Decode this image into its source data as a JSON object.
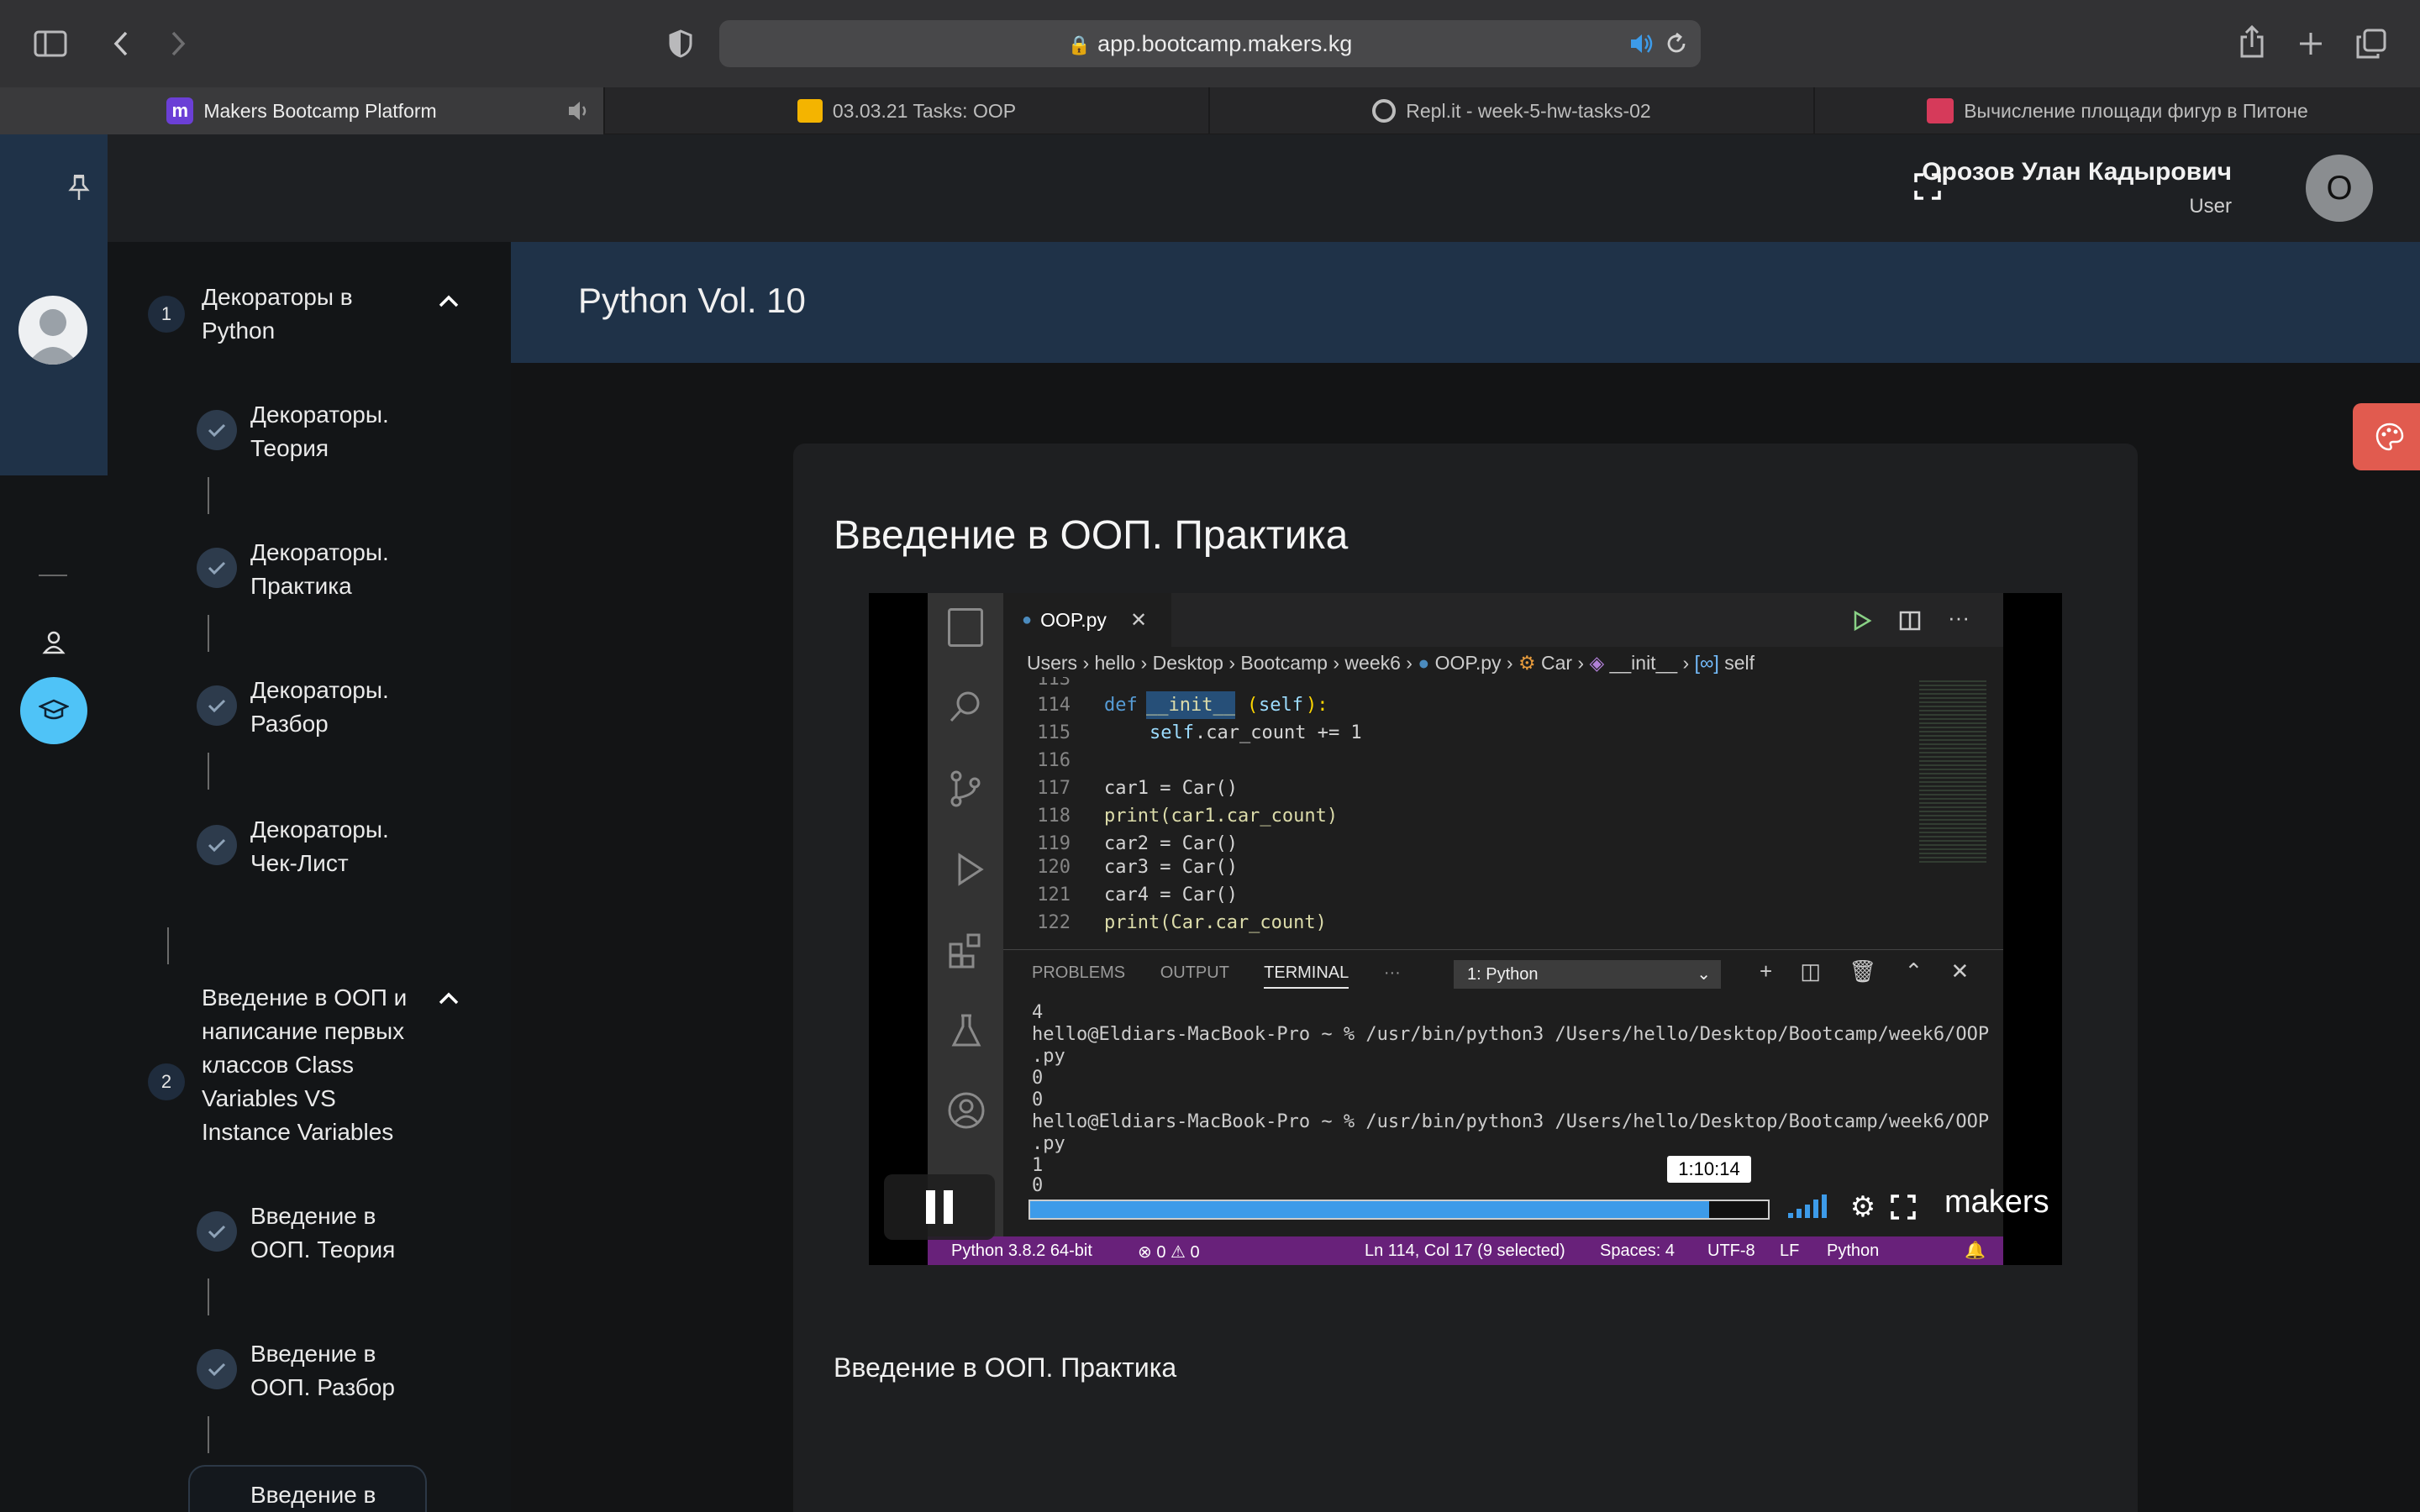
{
  "browser": {
    "url": "app.bootcamp.makers.kg",
    "tabs": [
      {
        "title": "Makers Bootcamp Platform",
        "active": true
      },
      {
        "title": "03.03.21 Tasks: OOP",
        "active": false
      },
      {
        "title": "Repl.it - week-5-hw-tasks-02",
        "active": false
      },
      {
        "title": "Вычисление площади фигур в Питоне",
        "active": false
      }
    ]
  },
  "user": {
    "name": "Орозов Улан Кадырович",
    "role": "User",
    "initial": "О"
  },
  "sidebar": {
    "modules": [
      {
        "number": "1",
        "title_lines": [
          "Декораторы в",
          "Python"
        ],
        "lessons": [
          {
            "lines": [
              "Декораторы.",
              "Теория"
            ]
          },
          {
            "lines": [
              "Декораторы.",
              "Практика"
            ]
          },
          {
            "lines": [
              "Декораторы.",
              "Разбор"
            ]
          },
          {
            "lines": [
              "Декораторы.",
              "Чек-Лист"
            ]
          }
        ]
      },
      {
        "number": "2",
        "title_lines": [
          "Введение в ООП и",
          "написание первых",
          "классов Class",
          "Variables VS",
          "Instance Variables"
        ],
        "lessons": [
          {
            "lines": [
              "Введение в",
              "ООП. Теория"
            ]
          },
          {
            "lines": [
              "Введение в",
              "ООП. Разбор"
            ]
          },
          {
            "lines": [
              "Введение в"
            ]
          }
        ]
      }
    ]
  },
  "main": {
    "course_title": "Python Vol. 10",
    "lesson_heading": "Введение в ООП. Практика",
    "lesson_caption": "Введение в ООП. Практика"
  },
  "video": {
    "time": "1:10:14",
    "progress": 0.92,
    "brand": "makers",
    "vscode": {
      "tab": "OOP.py",
      "breadcrumb": [
        "Users",
        "hello",
        "Desktop",
        "Bootcamp",
        "week6",
        "OOP.py",
        "Car",
        "__init__",
        "self"
      ],
      "code_lines": [
        {
          "n": "113",
          "text": ""
        },
        {
          "n": "114",
          "text": "    def __init__(self):"
        },
        {
          "n": "115",
          "text": "        self.car_count += 1"
        },
        {
          "n": "116",
          "text": ""
        },
        {
          "n": "117",
          "text": "car1 = Car()"
        },
        {
          "n": "118",
          "text": "print(car1.car_count)"
        },
        {
          "n": "119",
          "text": "car2 = Car()"
        },
        {
          "n": "120",
          "text": "car3 = Car()"
        },
        {
          "n": "121",
          "text": "car4 = Car()"
        },
        {
          "n": "122",
          "text": "print(Car.car_count)"
        }
      ],
      "panel_tabs": [
        "PROBLEMS",
        "OUTPUT",
        "TERMINAL",
        "···"
      ],
      "terminal_select": "1: Python",
      "terminal_lines": [
        "4",
        "hello@Eldiars-MacBook-Pro ~ % /usr/bin/python3 /Users/hello/Desktop/Bootcamp/week6/OOP",
        ".py",
        "0",
        "0",
        "hello@Eldiars-MacBook-Pro ~ % /usr/bin/python3 /Users/hello/Desktop/Bootcamp/week6/OOP",
        ".py",
        "1",
        "0"
      ],
      "status": {
        "python": "Python 3.8.2 64-bit",
        "problems": "⊗ 0 ⚠ 0",
        "position": "Ln 114, Col 17 (9 selected)",
        "spaces": "Spaces: 4",
        "encoding": "UTF-8",
        "eol": "LF",
        "language": "Python"
      }
    }
  },
  "colors": {
    "accent": "#4fc3f7",
    "banner": "#1f3248",
    "palette_button": "#e15b4f",
    "progress": "#3d9be9"
  }
}
